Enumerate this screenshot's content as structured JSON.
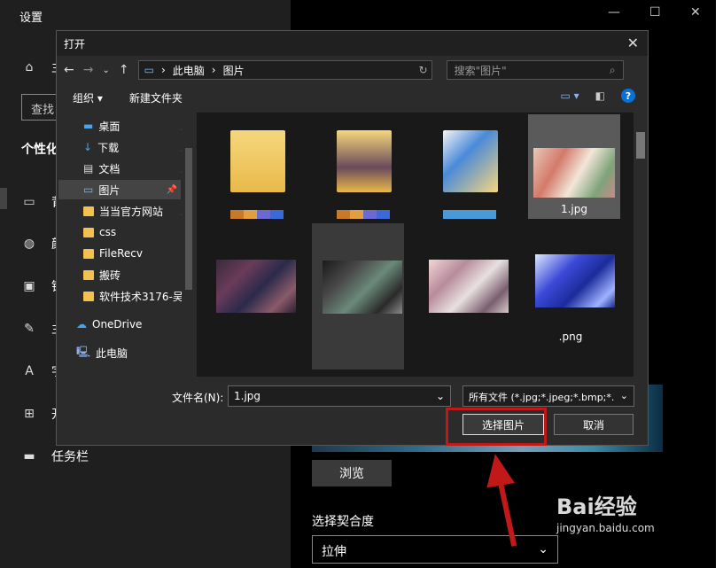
{
  "settings": {
    "title": "设置",
    "nav_items": [
      "主",
      "查找",
      "个性化",
      "背",
      "颜",
      "锁",
      "主",
      "字",
      "开",
      "任务栏"
    ],
    "search_placeholder": "查找",
    "section_title": "个性化",
    "browse_label": "浏览",
    "fit_label": "选择契合度",
    "fit_value": "拉伸"
  },
  "dialog": {
    "title": "打开",
    "breadcrumb": [
      "此电脑",
      "图片"
    ],
    "search_placeholder": "搜索\"图片\"",
    "toolbar": {
      "organize": "组织",
      "new_folder": "新建文件夹"
    },
    "tree": [
      {
        "label": "桌面",
        "pinned": true
      },
      {
        "label": "下载",
        "pinned": true
      },
      {
        "label": "文档",
        "pinned": true
      },
      {
        "label": "图片",
        "pinned": true
      },
      {
        "label": "当当官方网站",
        "pinned": true
      },
      {
        "label": "css",
        "pinned": false
      },
      {
        "label": "FileRecv",
        "pinned": false
      },
      {
        "label": "搬砖",
        "pinned": false
      },
      {
        "label": "软件技术3176-吴",
        "pinned": false
      },
      {
        "label": "OneDrive",
        "pinned": false
      },
      {
        "label": "此电脑",
        "pinned": false
      }
    ],
    "files": [
      {
        "label": ""
      },
      {
        "label": ""
      },
      {
        "label": ""
      },
      {
        "label": "1.jpg"
      },
      {
        "label": ""
      },
      {
        "label": ""
      },
      {
        "label": ""
      },
      {
        "label": ".png"
      }
    ],
    "filename_label": "文件名(N):",
    "filename_value": "1.jpg",
    "filetype_value": "所有文件 (*.jpg;*.jpeg;*.bmp;*.",
    "select_button": "选择图片",
    "cancel_button": "取消"
  },
  "watermark": {
    "logo": "Bai经验",
    "url": "jingyan.baidu.com"
  },
  "colors": {
    "accent": "#0a6fd6",
    "highlight": "#c11818",
    "folder": "#f2c14e"
  }
}
